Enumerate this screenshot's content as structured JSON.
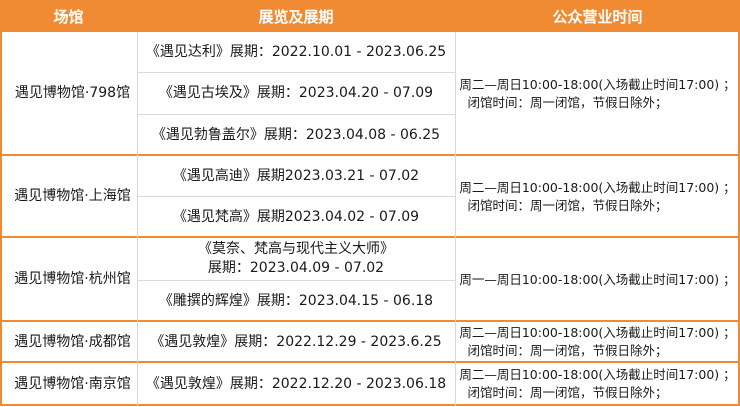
{
  "header": {
    "venue": "场馆",
    "exhibition": "展览及展期",
    "hours": "公众营业时间"
  },
  "rows": [
    {
      "venue": "遇见博物馆·798馆",
      "exhibitions": [
        "《遇见达利》展期：2022.10.01 - 2023.06.25",
        "《遇见古埃及》展期：2023.04.20 - 07.09",
        "《遇见勃鲁盖尔》展期：2023.04.08 - 06.25"
      ],
      "hours_line1": "周二—周日10:00-18:00(入场截止时间17:00) ；",
      "hours_line2": "闭馆时间：周一闭馆，节假日除外；"
    },
    {
      "venue": "遇见博物馆·上海馆",
      "exhibitions": [
        "《遇见高迪》展期2023.03.21 - 07.02",
        "《遇见梵高》展期2023.04.02 - 07.09"
      ],
      "hours_line1": "周二—周日10:00-18:00(入场截止时间17:00) ；",
      "hours_line2": "闭馆时间：周一闭馆，节假日除外；"
    },
    {
      "venue": "遇见博物馆·杭州馆",
      "exhibitions": [
        "《莫奈、梵高与现代主义大师》",
        "展期：2023.04.09 - 07.02",
        "《雕撰的辉煌》展期：2023.04.15 - 06.18"
      ],
      "hours_line1": "周一—周日10:00-18:00(入场截止时间17:00) ；"
    },
    {
      "venue": "遇见博物馆·成都馆",
      "exhibitions": [
        "《遇见敦煌》展期：2022.12.29 - 2023.6.25"
      ],
      "hours_line1": "周二—周日10:00-18:00(入场截止时间17:00) ；",
      "hours_line2": "闭馆时间：周一闭馆，节假日除外；"
    },
    {
      "venue": "遇见博物馆·南京馆",
      "exhibitions": [
        "《遇见敦煌》展期：2022.12.20 - 2023.06.18"
      ],
      "hours_line1": "周二—周日10:00-18:00(入场截止时间17:00) ；",
      "hours_line2": "闭馆时间：周一闭馆，节假日除外；"
    }
  ],
  "colors": {
    "header_bg": "#f08a33",
    "header_text": "#ffffff",
    "grid": "#d9d9d9"
  }
}
